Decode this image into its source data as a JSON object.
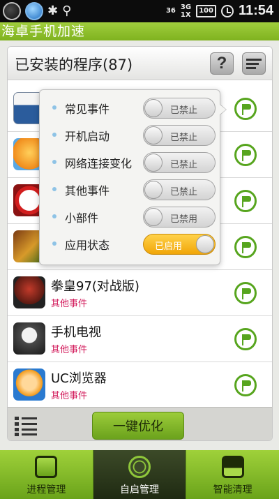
{
  "status_bar": {
    "indicators": [
      "36",
      "3G",
      "1X"
    ],
    "battery": "100",
    "time": "11:54"
  },
  "app": {
    "title": "海卓手机加速"
  },
  "panel": {
    "title": "已安装的程序(87)",
    "help_label": "?",
    "apps": [
      {
        "name": "",
        "tag": "",
        "icon": "calendar-365-icon"
      },
      {
        "name": "",
        "tag": "",
        "icon": "chat-bubble-icon"
      },
      {
        "name": "",
        "tag": "",
        "icon": "block-icon"
      },
      {
        "name": "",
        "tag": "",
        "icon": "game-icon"
      },
      {
        "name": "拳皇97(对战版)",
        "tag": "其他事件",
        "icon": "fighter-game-icon"
      },
      {
        "name": "手机电视",
        "tag": "其他事件",
        "icon": "tv-app-icon"
      },
      {
        "name": "UC浏览器",
        "tag": "其他事件",
        "icon": "uc-browser-icon"
      }
    ],
    "optimize_label": "一键优化"
  },
  "popup": {
    "items": [
      {
        "label": "常见事件",
        "state": "已禁止",
        "on": false
      },
      {
        "label": "开机启动",
        "state": "已禁止",
        "on": false
      },
      {
        "label": "网络连接变化",
        "state": "已禁止",
        "on": false
      },
      {
        "label": "其他事件",
        "state": "已禁止",
        "on": false
      },
      {
        "label": "小部件",
        "state": "已禁用",
        "on": false
      },
      {
        "label": "应用状态",
        "state": "已启用",
        "on": true
      }
    ]
  },
  "tabs": [
    {
      "label": "进程管理",
      "icon": "process-icon",
      "active": false
    },
    {
      "label": "自启管理",
      "icon": "autostart-icon",
      "active": true
    },
    {
      "label": "智能清理",
      "icon": "auto-clean-icon",
      "active": false
    }
  ],
  "colors": {
    "accent_green": "#7fb21f",
    "tag_pink": "#d2195a",
    "toggle_on": "#f1a608"
  }
}
